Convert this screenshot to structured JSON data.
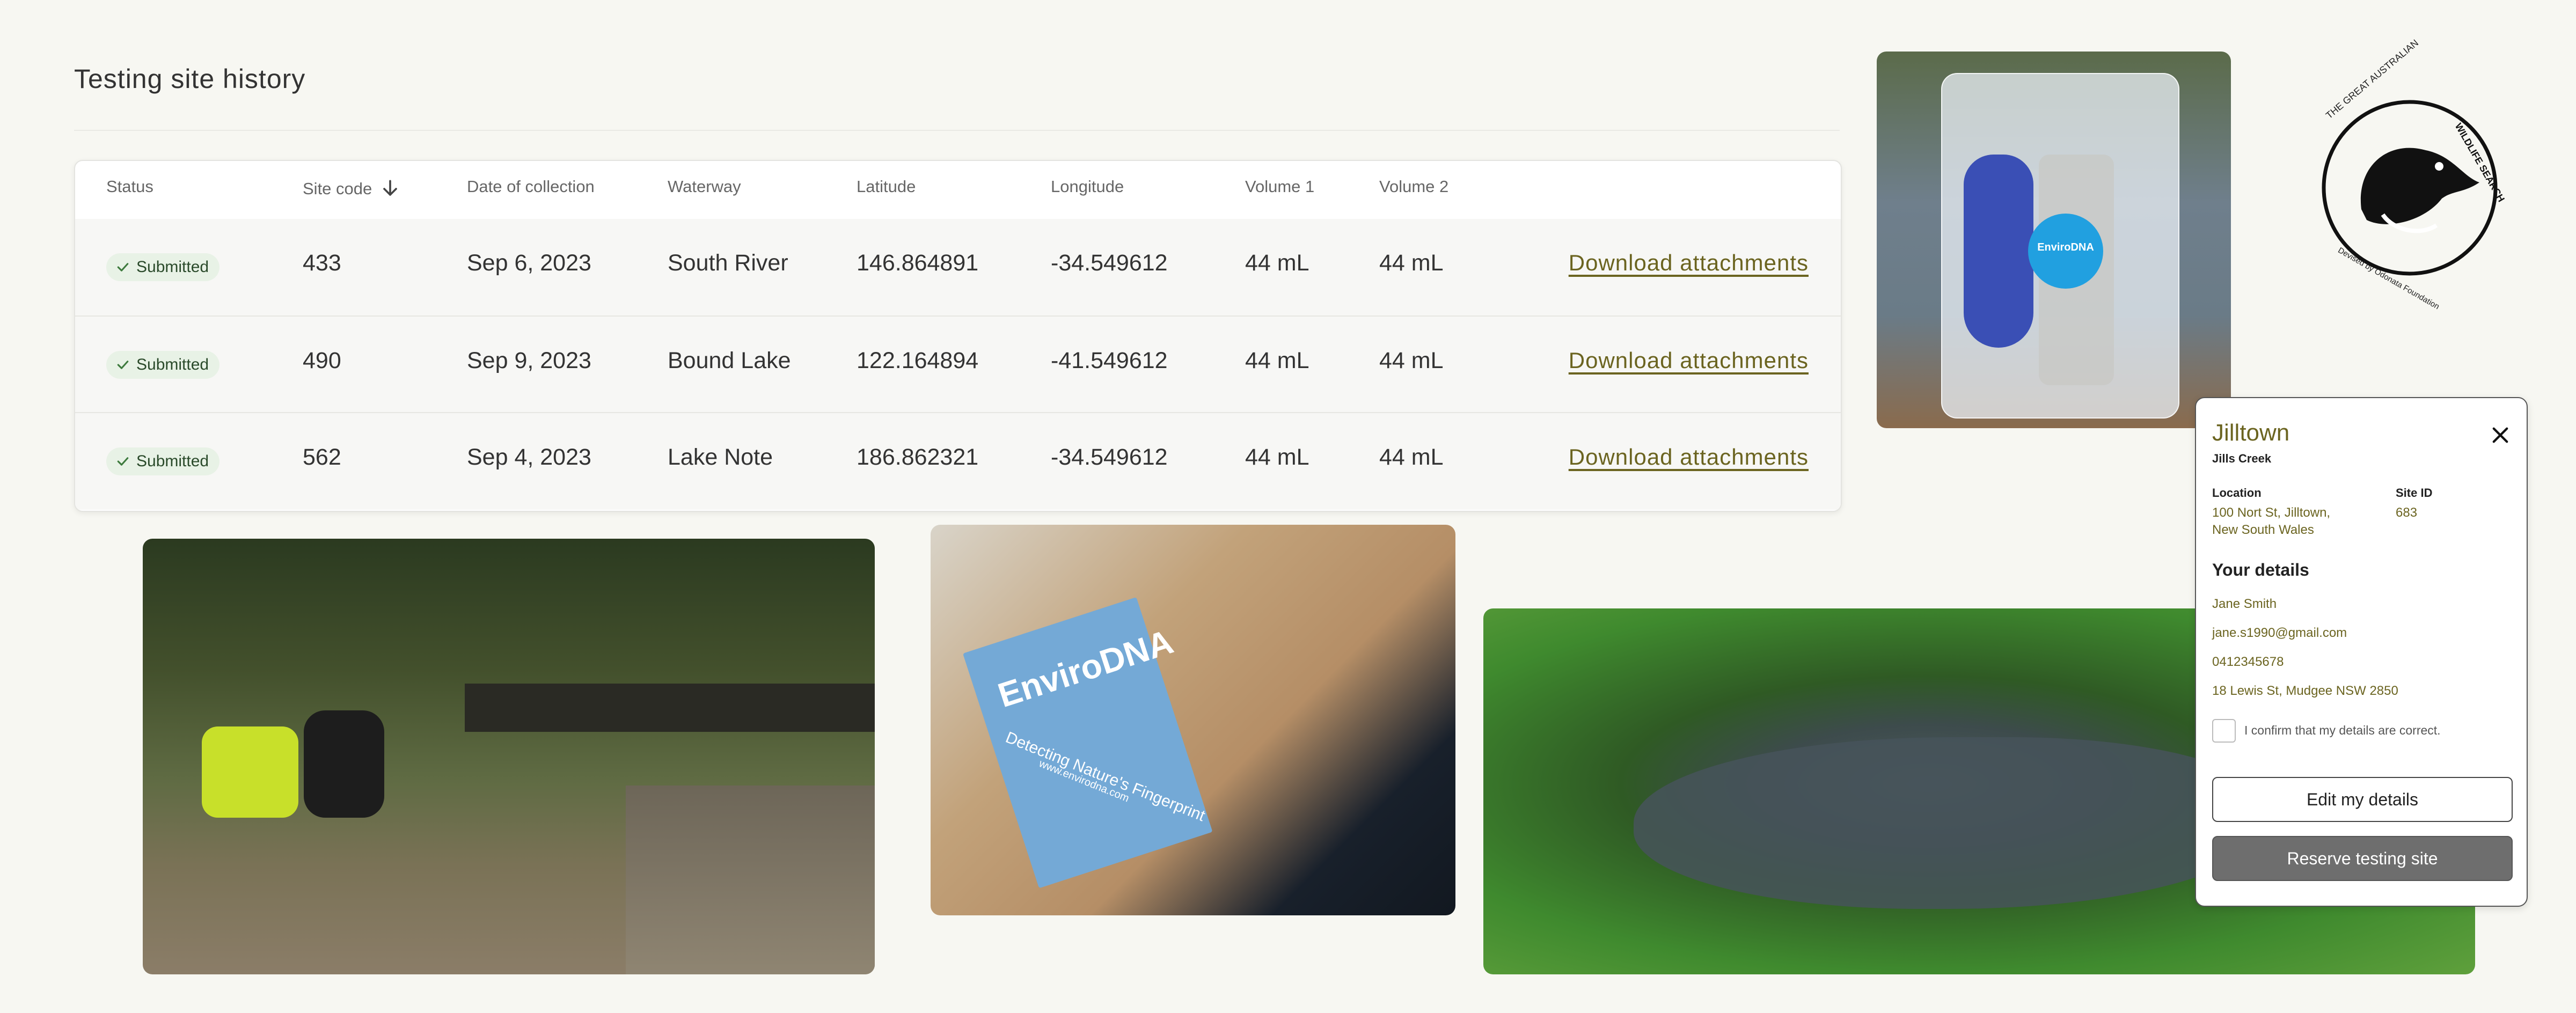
{
  "page": {
    "title": "Testing site history"
  },
  "table": {
    "headers": {
      "status": "Status",
      "site_code": "Site code",
      "date": "Date of collection",
      "waterway": "Waterway",
      "latitude": "Latitude",
      "longitude": "Longitude",
      "volume1": "Volume 1",
      "volume2": "Volume 2"
    },
    "rows": [
      {
        "status": "Submitted",
        "site_code": "433",
        "date": "Sep 6, 2023",
        "waterway": "South River",
        "latitude": "146.864891",
        "longitude": "-34.549612",
        "volume1": "44 mL",
        "volume2": "44 mL",
        "action": "Download attachments"
      },
      {
        "status": "Submitted",
        "site_code": "490",
        "date": "Sep 9, 2023",
        "waterway": "Bound Lake",
        "latitude": "122.164894",
        "longitude": "-41.549612",
        "volume1": "44 mL",
        "volume2": "44 mL",
        "action": "Download attachments"
      },
      {
        "status": "Submitted",
        "site_code": "562",
        "date": "Sep 4, 2023",
        "waterway": "Lake Note",
        "latitude": "186.862321",
        "longitude": "-34.549612",
        "volume1": "44 mL",
        "volume2": "44 mL",
        "action": "Download attachments"
      }
    ]
  },
  "photos": {
    "box_brand": "EnviroDNA",
    "box_tagline": "Detecting Nature's Fingerprint",
    "box_url": "www.envirodna.com",
    "bag_brand": "EnviroDNA"
  },
  "logo": {
    "ring_text_1": "THE GREAT AUSTRALIAN",
    "ring_text_2": "WILDLIFE SEARCH",
    "byline": "Devised by Odonata Foundation"
  },
  "panel": {
    "title": "Jilltown",
    "subtitle": "Jills Creek",
    "location_label": "Location",
    "location_line1": "100 Nort St, Jilltown,",
    "location_line2": "New South Wales",
    "site_id_label": "Site ID",
    "site_id": "683",
    "your_details_heading": "Your details",
    "name": "Jane Smith",
    "email": "jane.s1990@gmail.com",
    "phone": "0412345678",
    "address": "18 Lewis St, Mudgee NSW 2850",
    "confirm_label": "I confirm that my details are correct.",
    "edit_button": "Edit my details",
    "reserve_button": "Reserve testing site"
  },
  "colors": {
    "accent": "#6b6420",
    "badge_bg": "#e8f2e6",
    "badge_check": "#3d7a3d",
    "page_bg": "#f7f7f2"
  }
}
